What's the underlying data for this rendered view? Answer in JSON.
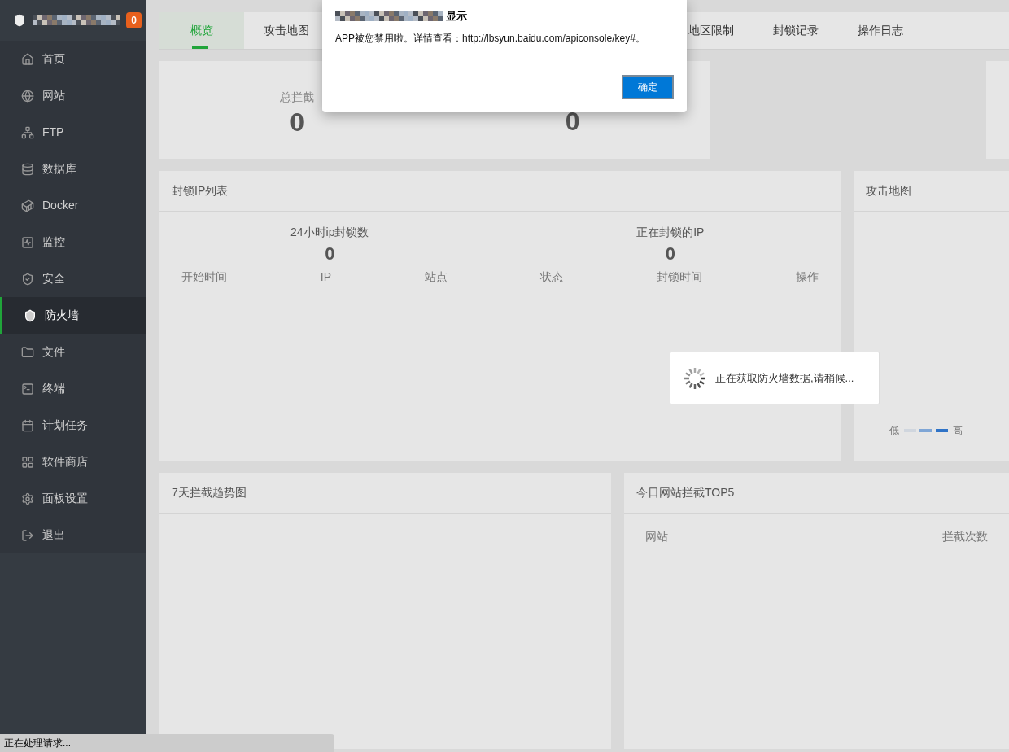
{
  "sidebar": {
    "badge": "0",
    "items": [
      {
        "label": "首页",
        "selected": false
      },
      {
        "label": "网站",
        "selected": false
      },
      {
        "label": "FTP",
        "selected": false
      },
      {
        "label": "数据库",
        "selected": false
      },
      {
        "label": "Docker",
        "selected": false
      },
      {
        "label": "监控",
        "selected": false
      },
      {
        "label": "安全",
        "selected": false
      },
      {
        "label": "防火墙",
        "selected": true
      },
      {
        "label": "文件",
        "selected": false
      },
      {
        "label": "终端",
        "selected": false
      },
      {
        "label": "计划任务",
        "selected": false
      },
      {
        "label": "软件商店",
        "selected": false
      },
      {
        "label": "面板设置",
        "selected": false
      },
      {
        "label": "退出",
        "selected": false
      }
    ]
  },
  "tabs_left": [
    {
      "label": "概览",
      "selected": true
    },
    {
      "label": "攻击地图",
      "selected": false
    }
  ],
  "tabs_right": [
    {
      "label": "地区限制",
      "selected": false
    },
    {
      "label": "封锁记录",
      "selected": false
    },
    {
      "label": "操作日志",
      "selected": false
    }
  ],
  "overview": {
    "stats": [
      {
        "label": "总拦截",
        "value": "0"
      },
      {
        "value": "0"
      }
    ]
  },
  "blocked_ip": {
    "title": "封锁IP列表",
    "stats": [
      {
        "label": "24小时ip封锁数",
        "value": "0"
      },
      {
        "label": "正在封锁的IP",
        "value": "0"
      }
    ],
    "columns": [
      "开始时间",
      "IP",
      "站点",
      "状态",
      "封锁时间",
      "操作"
    ]
  },
  "attack_map": {
    "title": "攻击地图",
    "legend_low": "低",
    "legend_high": "高"
  },
  "loading": {
    "text": "正在获取防火墙数据,请稍候..."
  },
  "trend": {
    "title": "7天拦截趋势图"
  },
  "top5": {
    "title": "今日网站拦截TOP5",
    "columns": [
      "网站",
      "拦截次数"
    ]
  },
  "dialog": {
    "title": "显示",
    "message": "APP被您禁用啦。详情查看：http://lbsyun.baidu.com/apiconsole/key#。",
    "button": "确定"
  },
  "status_bar": "正在处理请求..."
}
